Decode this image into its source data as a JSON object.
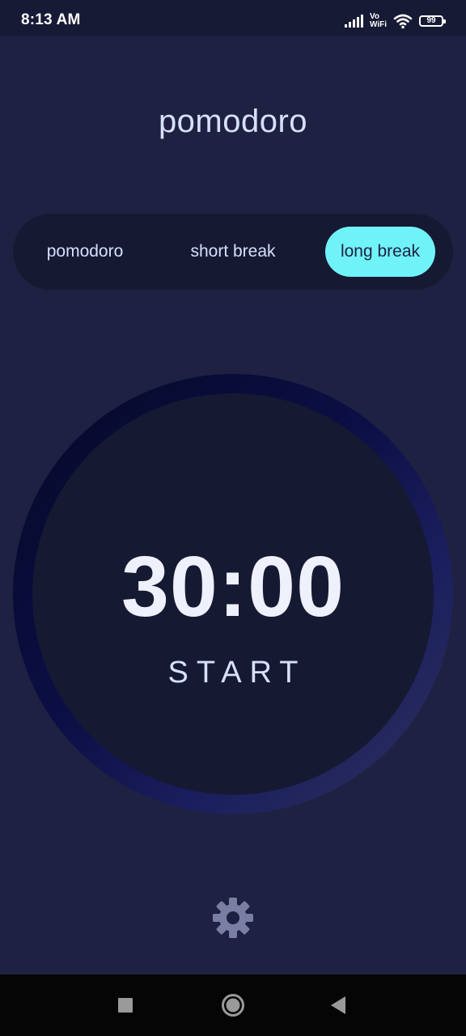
{
  "status_bar": {
    "time": "8:13 AM",
    "vo_label": "Vo",
    "wifi_label": "WiFi",
    "battery_level": "99"
  },
  "app": {
    "title": "pomodoro"
  },
  "modes": {
    "items": [
      {
        "label": "pomodoro",
        "active": false
      },
      {
        "label": "short break",
        "active": false
      },
      {
        "label": "long break",
        "active": true
      }
    ]
  },
  "timer": {
    "value": "30:00",
    "action_label": "START"
  },
  "settings": {
    "icon": "gear-icon"
  },
  "nav_bar": {
    "icons": [
      "recents-square-icon",
      "home-circle-icon",
      "back-triangle-icon"
    ]
  },
  "colors": {
    "background": "#1e2141",
    "panel": "#161932",
    "accent": "#70f3f8",
    "text": "#d7e0fb",
    "gear": "#7a7ea3"
  }
}
